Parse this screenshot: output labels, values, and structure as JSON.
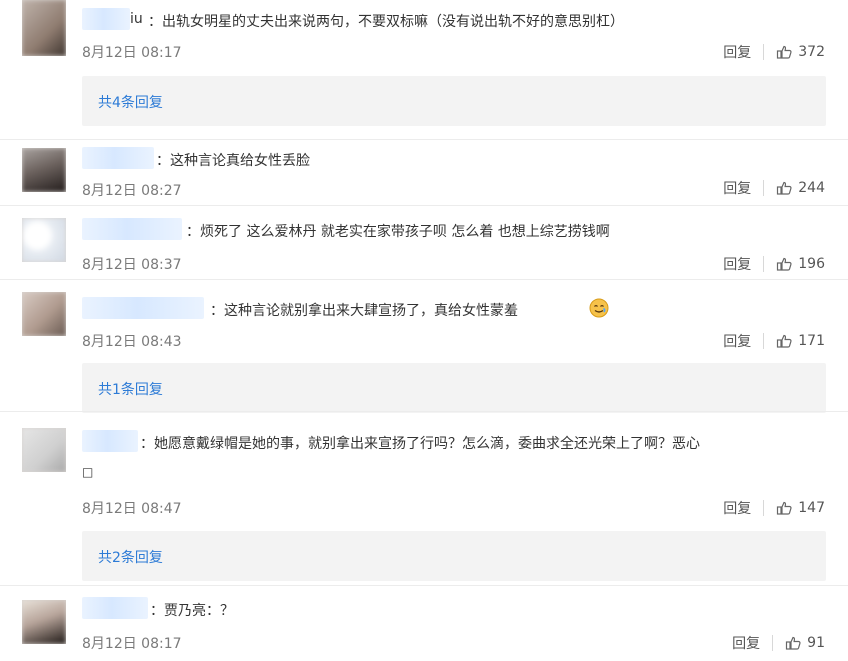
{
  "ui": {
    "reply_label": "回复"
  },
  "comments": [
    {
      "name_suffix": "iu",
      "text": "：出轨女明星的丈夫出来说两句，不要双标嘛（没有说出轨不好的意思别杠）",
      "time": "8月12日 08:17",
      "likes": "372",
      "replies_summary": "共4条回复"
    },
    {
      "text": "：这种言论真给女性丢脸",
      "time": "8月12日 08:27",
      "likes": "244"
    },
    {
      "text": "：烦死了   这么爱林丹 就老实在家带孩子呗  怎么着  也想上综艺捞钱啊",
      "time": "8月12日 08:37",
      "likes": "196"
    },
    {
      "text": "：这种言论就别拿出来大肆宣扬了，真给女性蒙羞",
      "time": "8月12日 08:43",
      "likes": "171",
      "replies_summary": "共1条回复"
    },
    {
      "text_line1": "：她愿意戴绿帽是她的事，就别拿出来宣扬了行吗？怎么滴，委曲求全还光荣上了啊？恶心",
      "text_line2": "□",
      "time": "8月12日 08:47",
      "likes": "147",
      "replies_summary": "共2条回复"
    },
    {
      "text": "：贾乃亮：？",
      "time": "8月12日 08:17",
      "likes": "91"
    }
  ]
}
